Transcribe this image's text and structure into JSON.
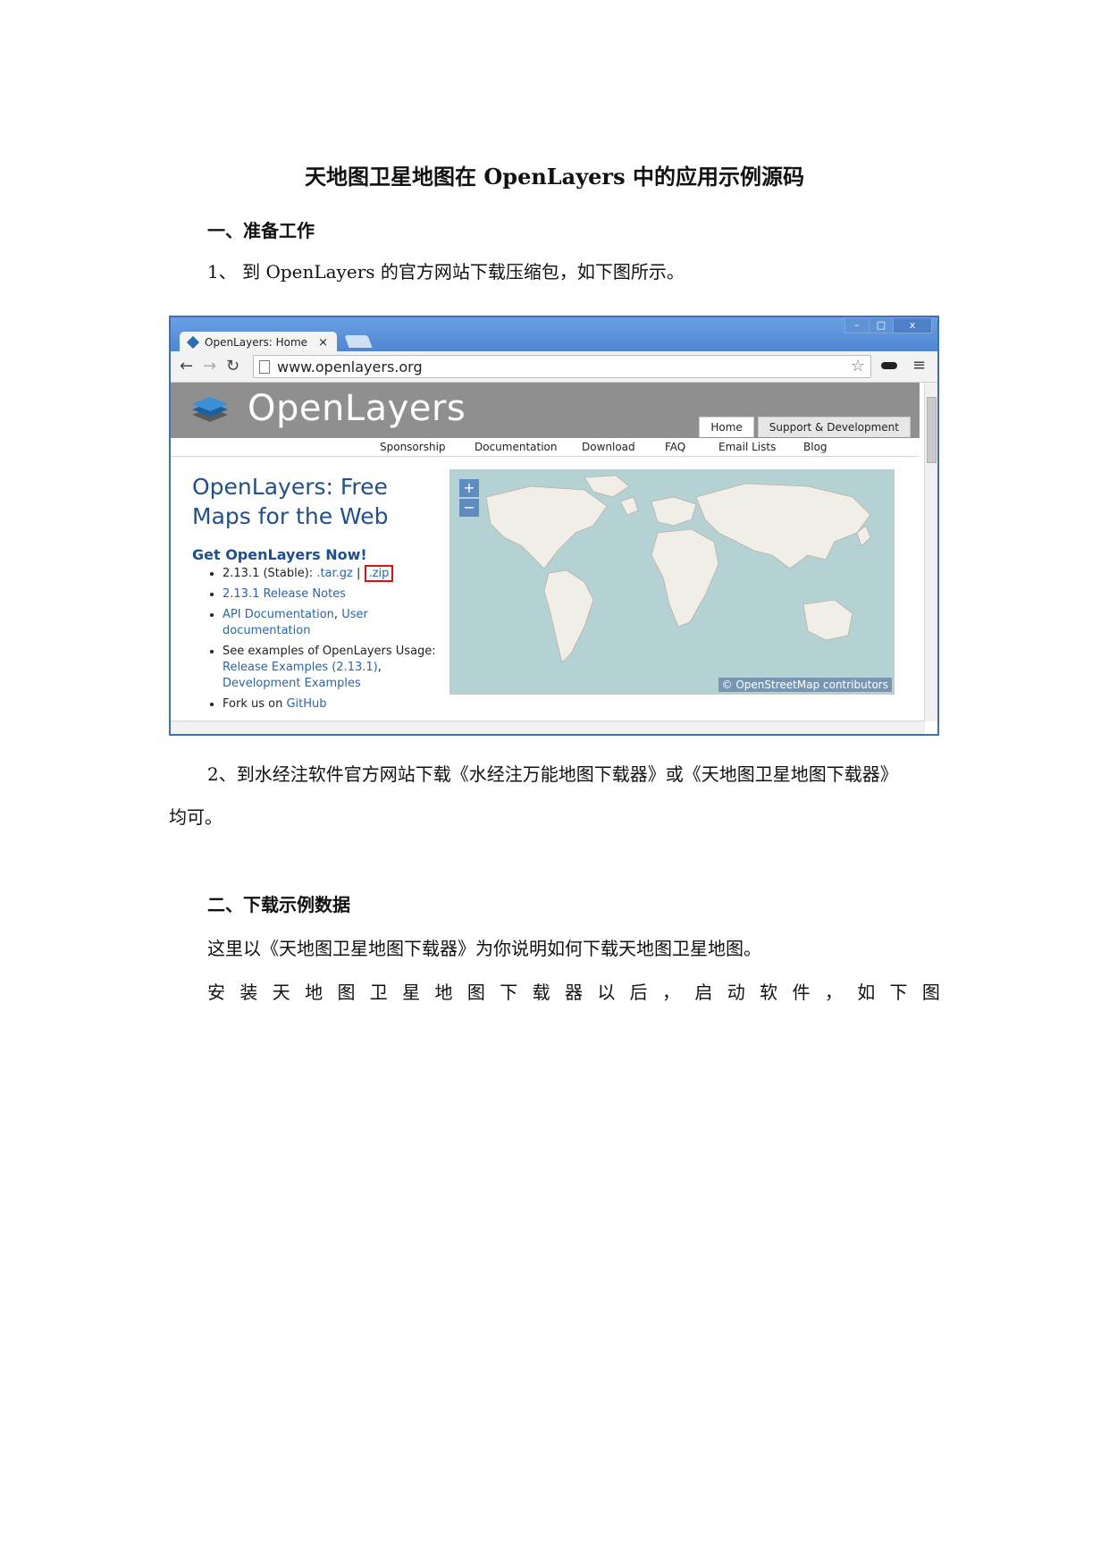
{
  "doc": {
    "title": "天地图卫星地图在 OpenLayers 中的应用示例源码",
    "section1": "一、准备工作",
    "step1": "1、  到 OpenLayers 的官方网站下载压缩包，如下图所示。",
    "step2_line1": "2、到水经注软件官方网站下载《水经注万能地图下载器》或《天地图卫星地图下载器》",
    "step2_line2": "均可。",
    "section2": "二、下载示例数据",
    "intro": "这里以《天地图卫星地图下载器》为你说明如何下载天地图卫星地图。",
    "install_chars": [
      "安",
      "装",
      "天",
      "地",
      "图",
      "卫",
      "星",
      "地",
      "图",
      "下",
      "载",
      "器",
      "以",
      "后",
      "，",
      "启",
      "动",
      "软",
      "件",
      "，",
      "如",
      "下",
      "图"
    ]
  },
  "browser": {
    "tab_title": "OpenLayers: Home",
    "tab_close": "×",
    "url": "www.openlayers.org",
    "win_min": "–",
    "win_max": "□",
    "win_close": "x",
    "page": {
      "logo_text": "OpenLayers",
      "top_tabs": [
        "Home",
        "Support & Development"
      ],
      "nav": [
        "Sponsorship",
        "Documentation",
        "Download",
        "FAQ",
        "Email Lists",
        "Blog"
      ],
      "headline_line1": "OpenLayers: Free",
      "headline_line2": "Maps for the Web",
      "get_now": "Get OpenLayers Now!",
      "stable_label": "2.13.1 (Stable):",
      "tar_link": ".tar.gz",
      "separator": "|",
      "zip_link": ".zip",
      "release_notes": "2.13.1 Release Notes",
      "api_docs": "API Documentation",
      "comma": ",",
      "user_docs": "User documentation",
      "examples_prefix": "See examples of OpenLayers Usage:",
      "release_examples": "Release Examples (2.13.1)",
      "dev_examples": "Development Examples",
      "fork_text": "Fork us on",
      "github": "GitHub",
      "zoom_in": "+",
      "zoom_out": "−",
      "attribution": "© OpenStreetMap contributors"
    },
    "colors": {
      "accent": "#1d4f91",
      "highlight_box": "#e01010",
      "window_frame": "#4e86d1",
      "map_water": "#b4d2d3",
      "map_land": "#f1eee8"
    }
  }
}
